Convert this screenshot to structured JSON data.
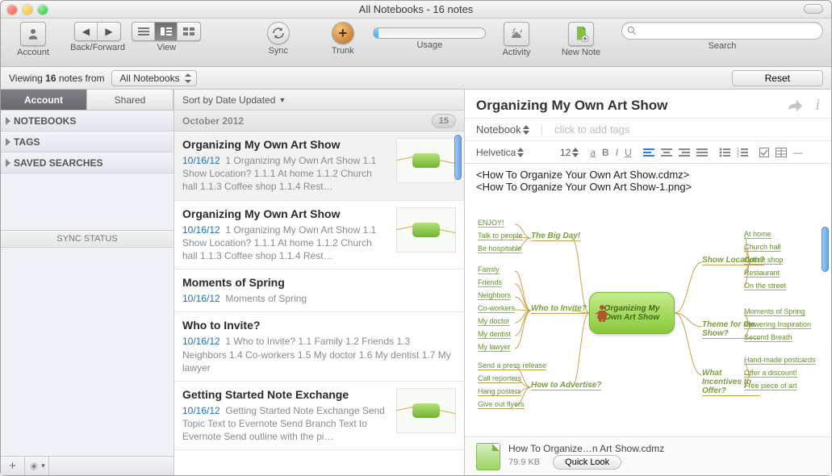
{
  "window": {
    "title": "All Notebooks - 16 notes"
  },
  "toolbar": {
    "account": "Account",
    "backfwd": "Back/Forward",
    "view": "View",
    "sync": "Sync",
    "trunk": "Trunk",
    "usage": "Usage",
    "activity": "Activity",
    "newnote": "New Note",
    "search": "Search"
  },
  "filter": {
    "prefix1": "Viewing ",
    "count": "16",
    "prefix2": " notes from ",
    "notebook": "All Notebooks",
    "reset": "Reset"
  },
  "sidebar": {
    "tab_account": "Account",
    "tab_shared": "Shared",
    "notebooks": "NOTEBOOKS",
    "tags": "TAGS",
    "saved": "SAVED SEARCHES",
    "sync_status": "SYNC STATUS"
  },
  "list": {
    "sort": "Sort by Date Updated",
    "month": "October 2012",
    "month_count": "15",
    "items": [
      {
        "title": "Organizing My Own Art Show",
        "date": "10/16/12",
        "snippet": "1 Organizing My Own Art Show 1.1 Show Location? 1.1.1 At home 1.1.2 Church hall 1.1.3 Coffee shop 1.1.4 Rest…",
        "thumb": true
      },
      {
        "title": "Organizing My Own Art Show",
        "date": "10/16/12",
        "snippet": "1 Organizing My Own Art Show 1.1 Show Location? 1.1.1 At home 1.1.2 Church hall 1.1.3 Coffee shop 1.1.4 Rest…",
        "thumb": true
      },
      {
        "title": "Moments of Spring",
        "date": "10/16/12",
        "snippet": "Moments of Spring",
        "thumb": false
      },
      {
        "title": "Who to Invite?",
        "date": "10/16/12",
        "snippet": "1 Who to Invite? 1.1 Family 1.2 Friends 1.3 Neighbors 1.4 Co-workers 1.5 My doctor 1.6 My dentist 1.7 My lawyer",
        "thumb": false
      },
      {
        "title": "Getting Started Note Exchange",
        "date": "10/16/12",
        "snippet": "Getting Started Note Exchange Send Topic Text to Evernote Send Branch Text to Evernote Send outline with the pi…",
        "thumb": true
      }
    ]
  },
  "editor": {
    "title": "Organizing My Own Art Show",
    "notebook_label": "Notebook",
    "tags_placeholder": "click to add tags",
    "font": "Helvetica",
    "size": "12",
    "line1": "<How To Organize Your Own Art Show.cdmz>",
    "line2": "<How To Organize Your Own Art Show-1.png>",
    "attachment": {
      "name": "How To Organize…n Art Show.cdmz",
      "size": "79.9 KB",
      "quicklook": "Quick Look"
    },
    "mindmap": {
      "center": "Organizing My Own Art Show",
      "branches_left": [
        {
          "label": "The Big Day!",
          "leaves": [
            "ENJOY!",
            "Talk to people",
            "Be hospitable"
          ]
        },
        {
          "label": "Who to Invite?",
          "leaves": [
            "Family",
            "Friends",
            "Neighbors",
            "Co-workers",
            "My doctor",
            "My dentist",
            "My lawyer"
          ]
        },
        {
          "label": "How to Advertise?",
          "leaves": [
            "Send a press release",
            "Call reporters",
            "Hang posters",
            "Give out flyers"
          ]
        }
      ],
      "branches_right": [
        {
          "label": "Show Location?",
          "leaves": [
            "At home",
            "Church hall",
            "Coffee shop",
            "Restaurant",
            "On the street"
          ]
        },
        {
          "label": "Theme for the Show?",
          "leaves": [
            "Moments of Spring",
            "Flowering Inspiration",
            "Second Breath"
          ]
        },
        {
          "label": "What Incentives to Offer?",
          "leaves": [
            "Hand-made postcards",
            "Offer a discount!",
            "Free piece of art"
          ]
        }
      ]
    }
  }
}
